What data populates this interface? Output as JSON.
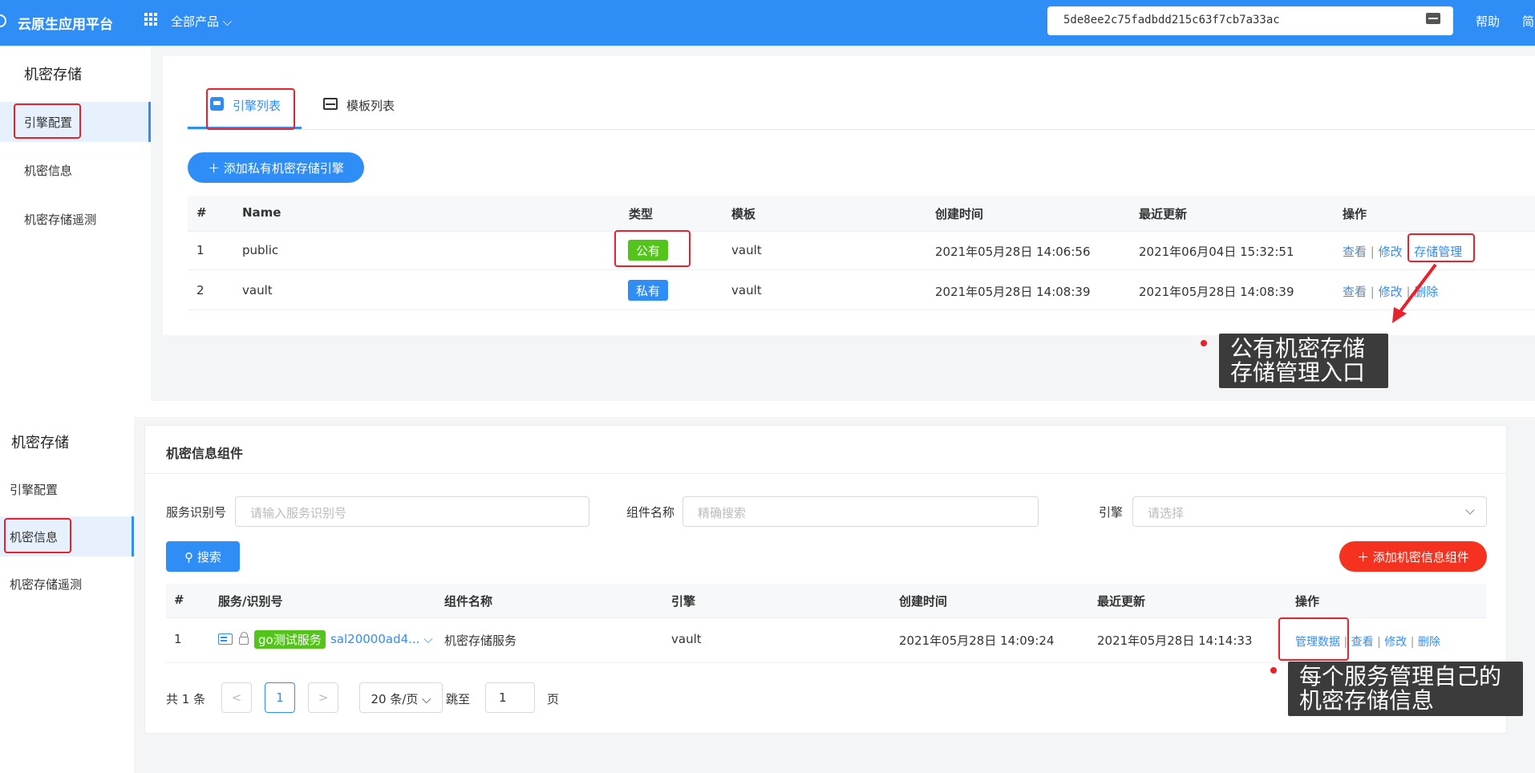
{
  "topbar": {
    "brand": "云原生应用平台",
    "products": "全部产品 ⌵",
    "token": "5de8ee2c75fadbdd215c63f7cb7a33ac",
    "help": "帮助",
    "lang": "简"
  },
  "panel1": {
    "sidebar": {
      "title": "机密存储",
      "items": [
        "引擎配置",
        "机密信息",
        "机密存储遥测"
      ]
    },
    "tabs": [
      "引擎列表",
      "模板列表"
    ],
    "add_button": "＋  添加私有机密存储引擎",
    "columns": [
      "#",
      "Name",
      "类型",
      "模板",
      "创建时间",
      "最近更新",
      "操作"
    ],
    "rows": [
      {
        "no": "1",
        "name": "public",
        "type": "公有",
        "template": "vault",
        "created": "2021年05月28日 14:06:56",
        "updated": "2021年06月04日 15:32:51",
        "actions": [
          "查看",
          "修改",
          "存储管理"
        ]
      },
      {
        "no": "2",
        "name": "vault",
        "type": "私有",
        "template": "vault",
        "created": "2021年05月28日 14:08:39",
        "updated": "2021年05月28日 14:08:39",
        "actions": [
          "查看",
          "修改",
          "删除"
        ]
      }
    ],
    "callout": [
      "公有机密存储",
      "存储管理入口"
    ]
  },
  "panel2": {
    "sidebar": {
      "title": "机密存储",
      "items": [
        "引擎配置",
        "机密信息",
        "机密存储遥测"
      ]
    },
    "card_title": "机密信息组件",
    "filters": {
      "service_label": "服务识别号",
      "service_placeholder": "请输入服务识别号",
      "component_label": "组件名称",
      "component_placeholder": "精确搜索",
      "engine_label": "引擎",
      "engine_placeholder": "请选择"
    },
    "search_button": "⚲  搜索",
    "add_button": "＋  添加机密信息组件",
    "columns": [
      "#",
      "服务/识别号",
      "组件名称",
      "引擎",
      "创建时间",
      "最近更新",
      "操作"
    ],
    "rows": [
      {
        "no": "1",
        "service_tag": "go测试服务",
        "service_id": "sal20000ad4... ⌵",
        "component": "机密存储服务",
        "engine": "vault",
        "created": "2021年05月28日 14:09:24",
        "updated": "2021年05月28日 14:14:33",
        "actions": [
          "管理数据",
          "查看",
          "修改",
          "删除"
        ]
      }
    ],
    "pager": {
      "total": "共 1 条",
      "prev": "<",
      "page": "1",
      "next": ">",
      "per_page": "20 条/页 ⌵",
      "jump": "跳至",
      "jump_value": "1",
      "page_unit": "页"
    },
    "callout": [
      "每个服务管理自己的",
      "机密存储信息"
    ]
  },
  "colors": {
    "primary": "#2f8ef5",
    "danger": "#f5321f",
    "success": "#52c41a",
    "highlight": "#e8222c"
  }
}
